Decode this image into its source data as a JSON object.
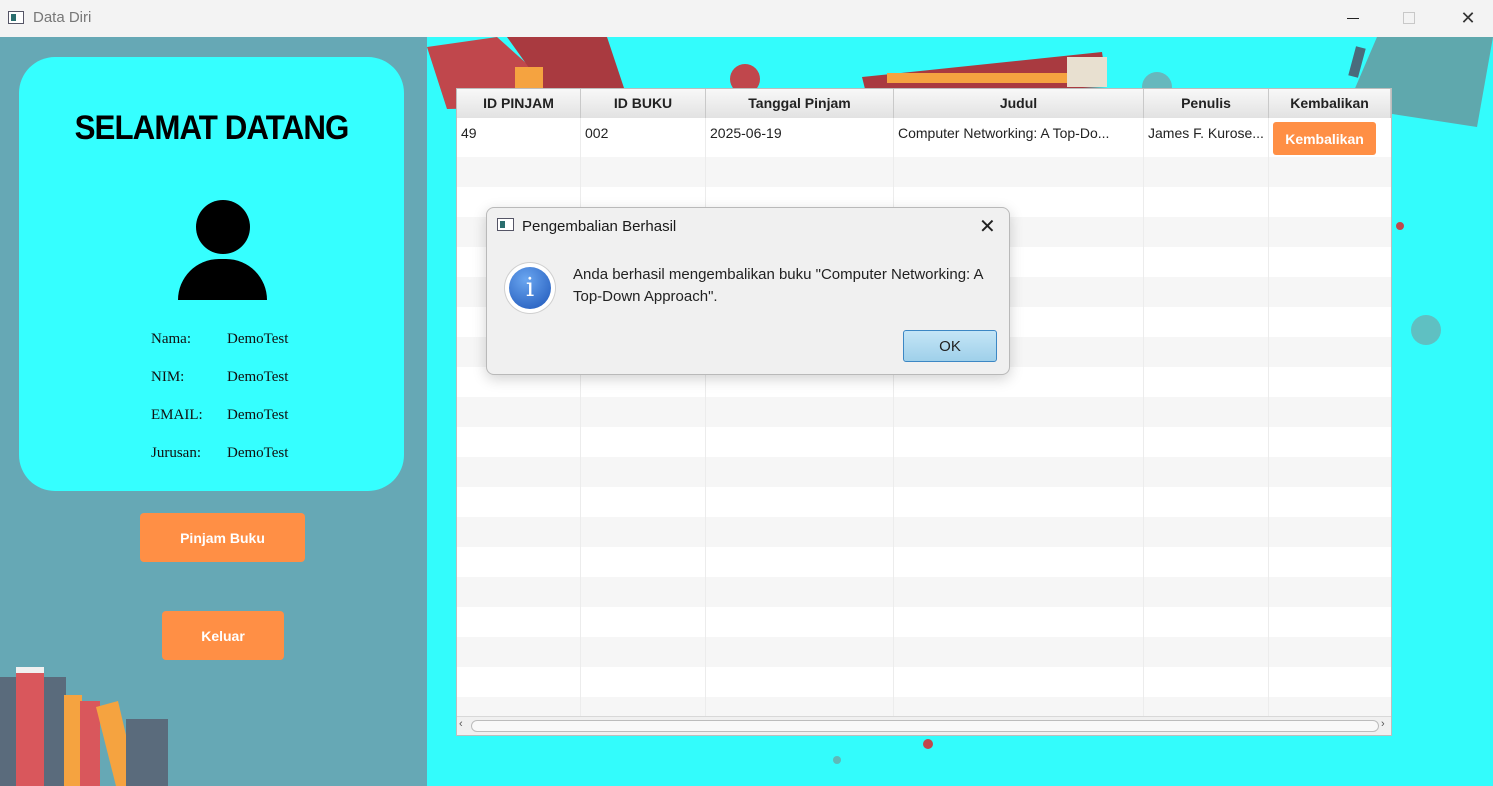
{
  "window": {
    "title": "Data Diri",
    "close_glyph": "✕"
  },
  "profile": {
    "welcome": "SELAMAT DATANG",
    "fields": [
      {
        "label": "Nama:",
        "value": "DemoTest"
      },
      {
        "label": "NIM:",
        "value": "DemoTest"
      },
      {
        "label": "EMAIL:",
        "value": "DemoTest"
      },
      {
        "label": "Jurusan:",
        "value": "DemoTest"
      }
    ],
    "pinjam_label": "Pinjam Buku",
    "keluar_label": "Keluar"
  },
  "table": {
    "columns": [
      "ID PINJAM",
      "ID BUKU",
      "Tanggal Pinjam",
      "Judul",
      "Penulis",
      "Kembalikan"
    ],
    "rows": [
      {
        "id_pinjam": "49",
        "id_buku": "002",
        "tanggal": "2025-06-19",
        "judul": "Computer Networking: A Top-Do...",
        "penulis": "James F. Kurose...",
        "action_label": "Kembalikan"
      }
    ],
    "scroll_left": "‹",
    "scroll_right": "›"
  },
  "dialog": {
    "title": "Pengembalian Berhasil",
    "message": "Anda berhasil mengembalikan buku \"Computer Networking: A Top-Down Approach\".",
    "ok_label": "OK",
    "close_glyph": "✕",
    "info_glyph": "i"
  },
  "colors": {
    "accent_orange": "#ff8f45",
    "cyan": "#33fcfc",
    "panel_teal": "#66a8b5"
  }
}
